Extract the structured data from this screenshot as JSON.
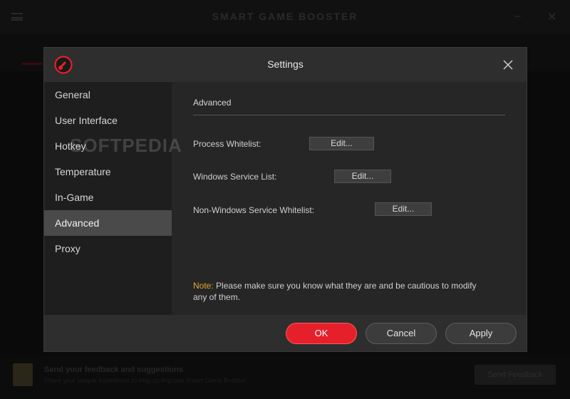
{
  "background": {
    "title": "SMART GAME BOOSTER",
    "feedback_title": "Send your feedback and suggestions",
    "feedback_subtitle": "Share your unique experience to help us improve Smart Game Booster.",
    "feedback_button": "Send Feedback"
  },
  "dialog": {
    "title": "Settings",
    "close_icon": "close-icon",
    "logo_icon": "gauge-logo-icon",
    "accent_color": "#e5202a"
  },
  "sidebar": {
    "items": [
      {
        "label": "General"
      },
      {
        "label": "User Interface"
      },
      {
        "label": "Hotkey"
      },
      {
        "label": "Temperature"
      },
      {
        "label": "In-Game"
      },
      {
        "label": "Advanced",
        "active": true
      },
      {
        "label": "Proxy"
      }
    ]
  },
  "advanced": {
    "section_title": "Advanced",
    "rows": [
      {
        "label": "Process Whitelist:",
        "button": "Edit..."
      },
      {
        "label": "Windows Service List:",
        "button": "Edit..."
      },
      {
        "label": "Non-Windows Service Whitelist:",
        "button": "Edit..."
      }
    ],
    "note_prefix": "Note:",
    "note_text": " Please make sure you know what they are and be cautious to modify any of them.",
    "note_color": "#e0a82e"
  },
  "watermark": "SOFTPEDIA",
  "footer": {
    "ok_label": "OK",
    "cancel_label": "Cancel",
    "apply_label": "Apply"
  }
}
